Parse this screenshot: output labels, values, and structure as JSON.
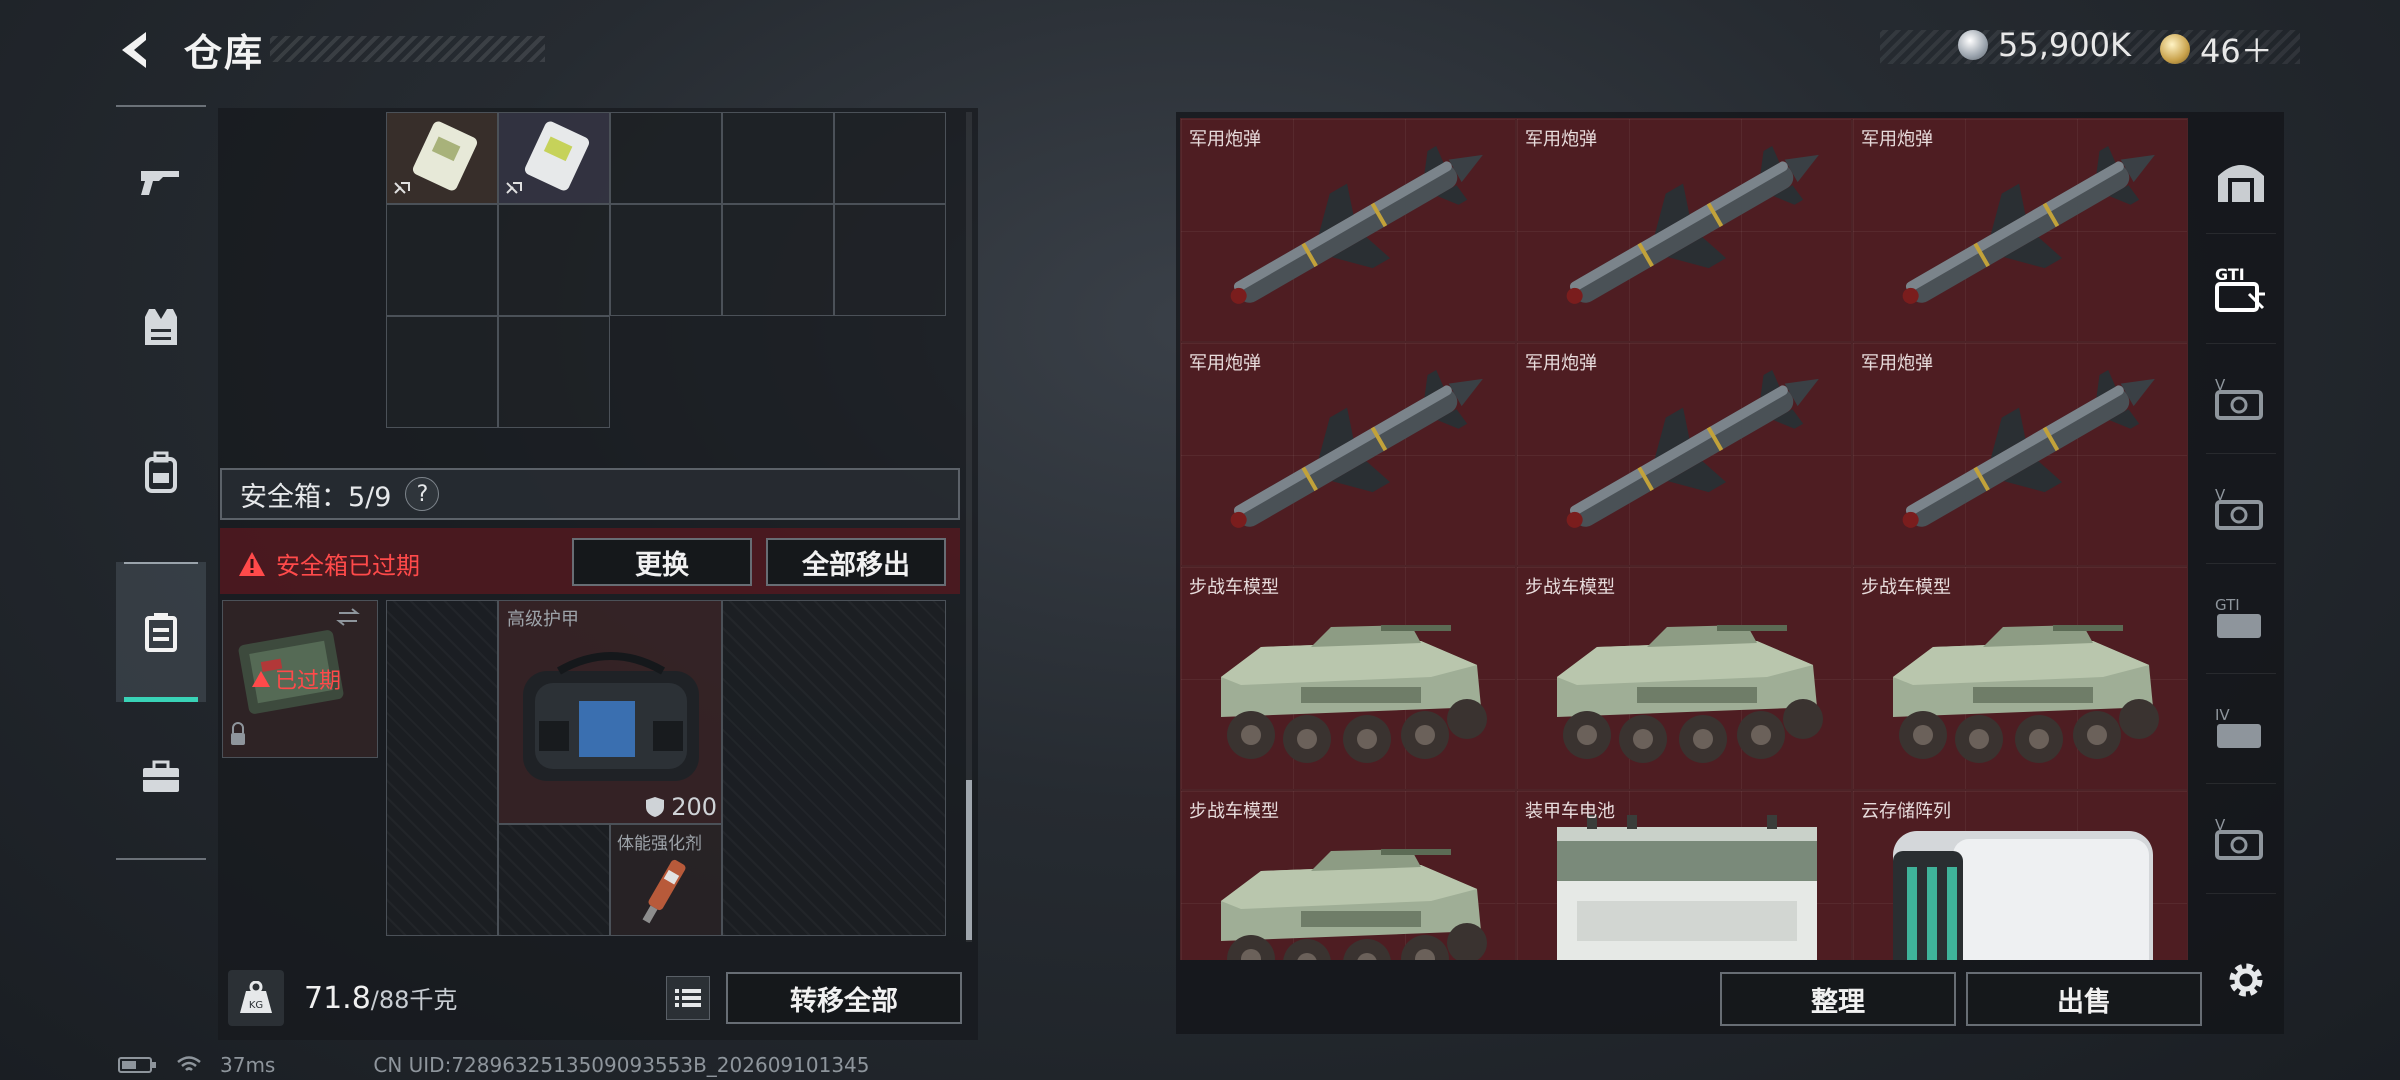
{
  "header": {
    "title": "仓库",
    "currency_1": "55,900K",
    "currency_2": "46＋"
  },
  "left_nav": {
    "items": [
      {
        "icon": "gun-icon"
      },
      {
        "icon": "vest-icon"
      },
      {
        "icon": "backpack-icon"
      },
      {
        "icon": "safebox-icon"
      },
      {
        "icon": "toolbox-icon"
      }
    ],
    "active_index": 3
  },
  "backpack": {
    "safebox_label": "安全箱：5/9",
    "help": "?",
    "expired_warning": "安全箱已过期",
    "replace_button": "更换",
    "remove_all_button": "全部移出",
    "expired_tag": "已过期",
    "armor_name": "高级护甲",
    "armor_value": "200",
    "boost_name": "体能强化剂",
    "weight_current": "71.8",
    "weight_capacity": "/88千克",
    "kg_icon_text": "KG",
    "transfer_all_button": "转移全部"
  },
  "storage": {
    "items": [
      {
        "name": "军用炮弹",
        "kind": "missile"
      },
      {
        "name": "军用炮弹",
        "kind": "missile"
      },
      {
        "name": "军用炮弹",
        "kind": "missile"
      },
      {
        "name": "军用炮弹",
        "kind": "missile"
      },
      {
        "name": "军用炮弹",
        "kind": "missile"
      },
      {
        "name": "军用炮弹",
        "kind": "missile"
      },
      {
        "name": "步战车模型",
        "kind": "ifv"
      },
      {
        "name": "步战车模型",
        "kind": "ifv"
      },
      {
        "name": "步战车模型",
        "kind": "ifv"
      },
      {
        "name": "步战车模型",
        "kind": "ifv"
      },
      {
        "name": "装甲车电池",
        "kind": "battery"
      },
      {
        "name": "云存储阵列",
        "kind": "server"
      }
    ],
    "sort_button": "整理",
    "sell_button": "出售",
    "side_tools": [
      "warehouse-icon",
      "gti-icon",
      "v-card-icon",
      "v-card-icon",
      "gti-icon",
      "iv-card-icon",
      "v-card-icon"
    ]
  },
  "status_bar": {
    "ping": "37ms",
    "uid": "CN UID:7289632513509093553B_202609101345"
  }
}
